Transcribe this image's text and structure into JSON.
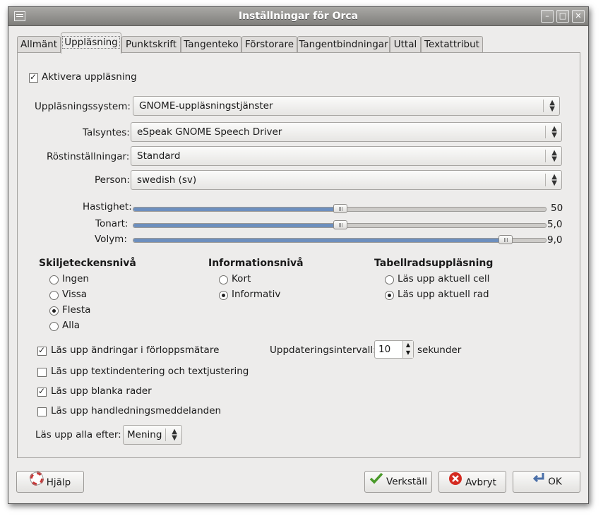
{
  "window": {
    "title": "Inställningar för Orca"
  },
  "tabs": [
    {
      "label": "Allmänt"
    },
    {
      "label": "Uppläsning"
    },
    {
      "label": "Punktskrift"
    },
    {
      "label": "Tangenteko"
    },
    {
      "label": "Förstorare"
    },
    {
      "label": "Tangentbindningar"
    },
    {
      "label": "Uttal"
    },
    {
      "label": "Textattribut"
    }
  ],
  "enable_speech": {
    "label": "Aktivera uppläsning",
    "checked": true
  },
  "speech_system": {
    "label": "Uppläsningssystem:",
    "value": "GNOME-uppläsningstjänster"
  },
  "synthesizer": {
    "label": "Talsyntes:",
    "value": "eSpeak GNOME Speech Driver"
  },
  "voice_settings": {
    "label": "Röstinställningar:",
    "value": "Standard"
  },
  "person": {
    "label": "Person:",
    "value": "swedish (sv)"
  },
  "rate": {
    "label": "Hastighet:",
    "value": "50",
    "fraction": 0.5
  },
  "pitch": {
    "label": "Tonart:",
    "value": "5,0",
    "fraction": 0.5
  },
  "volume": {
    "label": "Volym:",
    "value": "9,0",
    "fraction": 0.9
  },
  "punctuation": {
    "title": "Skiljeteckensnivå",
    "options": [
      {
        "label": "Ingen",
        "selected": false
      },
      {
        "label": "Vissa",
        "selected": false
      },
      {
        "label": "Flesta",
        "selected": true
      },
      {
        "label": "Alla",
        "selected": false
      }
    ]
  },
  "verbosity": {
    "title": "Informationsnivå",
    "options": [
      {
        "label": "Kort",
        "selected": false
      },
      {
        "label": "Informativ",
        "selected": true
      }
    ]
  },
  "table_rows": {
    "title": "Tabellradsuppläsning",
    "options": [
      {
        "label": "Läs upp aktuell cell",
        "selected": false
      },
      {
        "label": "Läs upp aktuell rad",
        "selected": true
      }
    ]
  },
  "checks": [
    {
      "label": "Läs upp ändringar i förloppsmätare",
      "checked": true
    },
    {
      "label": "Läs upp textindentering och textjustering",
      "checked": false
    },
    {
      "label": "Läs upp blanka rader",
      "checked": true
    },
    {
      "label": "Läs upp handledningsmeddelanden",
      "checked": false
    }
  ],
  "update_interval": {
    "label": "Uppdateringsintervall:",
    "value": "10",
    "unit": "sekunder"
  },
  "say_all": {
    "label": "Läs upp alla efter:",
    "value": "Mening"
  },
  "buttons": {
    "help": "Hjälp",
    "apply": "Verkställ",
    "cancel": "Avbryt",
    "ok": "OK"
  }
}
